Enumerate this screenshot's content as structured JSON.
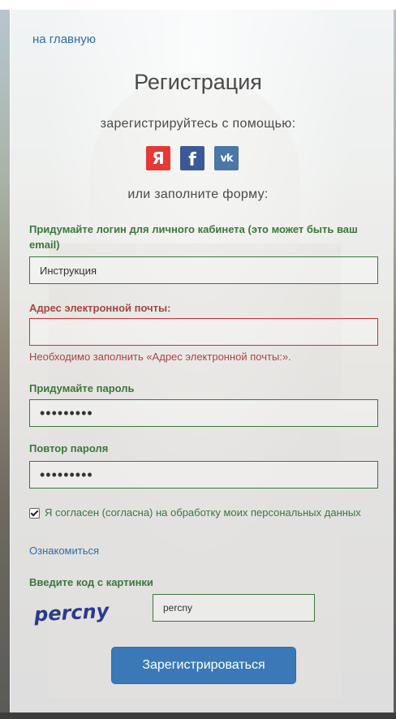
{
  "nav": {
    "home_link": "на главную"
  },
  "form": {
    "title": "Регистрация",
    "social_prompt": "зарегистрируйтесь с помощью:",
    "social_buttons": [
      {
        "name": "yandex-icon",
        "glyph": "Я",
        "color": "#e53935"
      },
      {
        "name": "facebook-icon",
        "glyph": "f",
        "color": "#3b5998"
      },
      {
        "name": "vk-icon",
        "glyph": "vk",
        "color": "#4a76a8"
      }
    ],
    "or_fill": "или заполните форму:",
    "login": {
      "label": "Придумайте логин для личного кабинета (это может быть ваш email)",
      "value": "Инструкция"
    },
    "email": {
      "label": "Адрес электронной почты:",
      "value": "",
      "error": "Необходимо заполнить «Адрес электронной почты:»."
    },
    "password": {
      "label": "Придумайте пароль",
      "value": "•••••••••"
    },
    "password_repeat": {
      "label": "Повтор пароля",
      "value": "•••••••••"
    },
    "consent": {
      "checked": true,
      "text": "Я согласен (согласна) на обработку моих персональных данных"
    },
    "read_link": "Ознакомиться",
    "captcha": {
      "label": "Введите код с картинки",
      "image_text": "percny",
      "value": "percny"
    },
    "submit_label": "Зарегистрироваться"
  },
  "colors": {
    "success": "#3c763d",
    "error": "#a94442",
    "link": "#2e6da4",
    "button": "#3a79b6",
    "captcha_text": "#2a3a8c"
  }
}
